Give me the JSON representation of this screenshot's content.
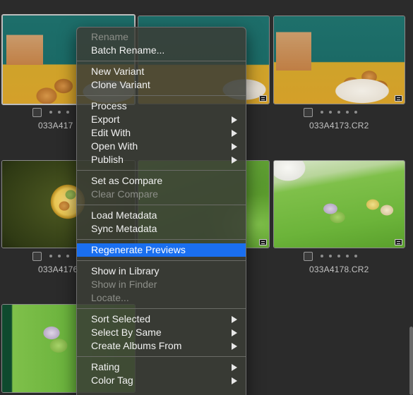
{
  "browser": {
    "tiles": [
      {
        "filename": "033A417",
        "selected": true
      },
      {
        "filename": "",
        "selected": false
      },
      {
        "filename": "033A4173.CR2",
        "selected": false
      },
      {
        "filename": "033A4176",
        "selected": false
      },
      {
        "filename": "",
        "selected": false
      },
      {
        "filename": "033A4178.CR2",
        "selected": false
      },
      {
        "filename": "",
        "selected": false
      }
    ]
  },
  "context_menu": {
    "groups": [
      [
        {
          "label": "Rename",
          "enabled": false,
          "submenu": false
        },
        {
          "label": "Batch Rename...",
          "enabled": true,
          "submenu": false
        }
      ],
      [
        {
          "label": "New Variant",
          "enabled": true,
          "submenu": false
        },
        {
          "label": "Clone Variant",
          "enabled": true,
          "submenu": false
        }
      ],
      [
        {
          "label": "Process",
          "enabled": true,
          "submenu": false
        },
        {
          "label": "Export",
          "enabled": true,
          "submenu": true
        },
        {
          "label": "Edit With",
          "enabled": true,
          "submenu": true
        },
        {
          "label": "Open With",
          "enabled": true,
          "submenu": true
        },
        {
          "label": "Publish",
          "enabled": true,
          "submenu": true
        }
      ],
      [
        {
          "label": "Set as Compare",
          "enabled": true,
          "submenu": false
        },
        {
          "label": "Clear Compare",
          "enabled": false,
          "submenu": false
        }
      ],
      [
        {
          "label": "Load Metadata",
          "enabled": true,
          "submenu": false
        },
        {
          "label": "Sync Metadata",
          "enabled": true,
          "submenu": false
        }
      ],
      [
        {
          "label": "Regenerate Previews",
          "enabled": true,
          "submenu": false,
          "highlighted": true
        }
      ],
      [
        {
          "label": "Show in Library",
          "enabled": true,
          "submenu": false
        },
        {
          "label": "Show in Finder",
          "enabled": false,
          "submenu": false
        },
        {
          "label": "Locate...",
          "enabled": false,
          "submenu": false
        }
      ],
      [
        {
          "label": "Sort Selected",
          "enabled": true,
          "submenu": true
        },
        {
          "label": "Select By Same",
          "enabled": true,
          "submenu": true
        },
        {
          "label": "Create Albums From",
          "enabled": true,
          "submenu": true
        }
      ],
      [
        {
          "label": "Rating",
          "enabled": true,
          "submenu": true
        },
        {
          "label": "Color Tag",
          "enabled": true,
          "submenu": true
        }
      ]
    ]
  },
  "colors": {
    "background": "#2b2b2b",
    "menu_highlight": "#1a6ff0",
    "menu_disabled_text": "#8c8e88"
  }
}
